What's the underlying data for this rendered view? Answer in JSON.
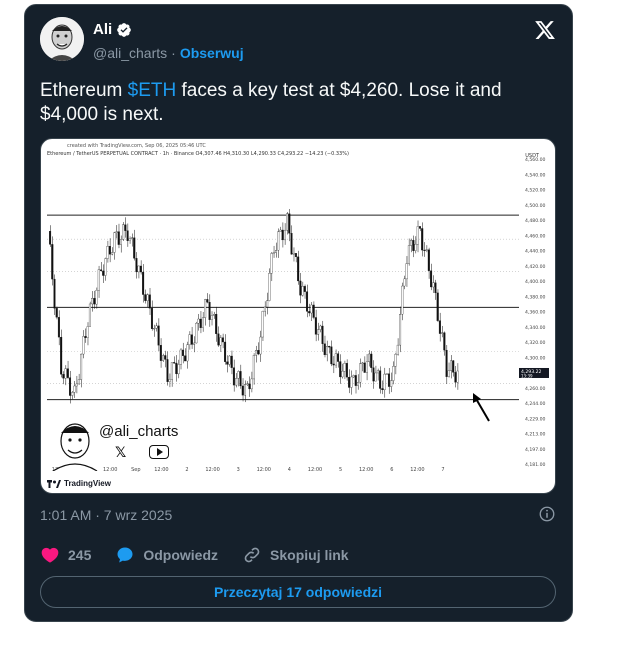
{
  "author": {
    "name": "Ali",
    "handle": "@ali_charts",
    "separator": "·",
    "follow_label": "Obserwuj",
    "verified": true
  },
  "tweet": {
    "text_before": "Ethereum ",
    "cashtag": "$ETH",
    "text_after": " faces a key test at $4,260. Lose it and $4,000 is next."
  },
  "media": {
    "created_with": "created with TradingView.com, Sep 06, 2025 05:46 UTC",
    "symbol_line": "Ethereum / TetherUS PERPETUAL CONTRACT · 1h · Binance  O4,307.46  H4,310.30  L4,290.33  C4,293.22  −14.23 (−0.33%)",
    "currency": "USDT",
    "price_ticks": [
      "4,560.00",
      "4,540.00",
      "4,520.00",
      "4,500.00",
      "4,480.00",
      "4,460.00",
      "4,440.00",
      "4,420.00",
      "4,400.00",
      "4,380.00",
      "4,360.00",
      "4,340.00",
      "4,320.00",
      "4,300.00",
      "4,280.00",
      "4,260.00",
      "4,244.00",
      "4,229.00",
      "4,213.00",
      "4,197.00",
      "4,181.00"
    ],
    "price_label": "4,293.22",
    "price_label_time": "13:39",
    "time_ticks": [
      "12:00",
      "31",
      "12:00",
      "Sep",
      "12:00",
      "2",
      "12:00",
      "3",
      "12:00",
      "4",
      "12:00",
      "5",
      "12:00",
      "6",
      "12:00",
      "7"
    ],
    "watermark_handle": "@ali_charts",
    "tv_brand": "TradingView"
  },
  "chart_data": {
    "type": "line",
    "title": "",
    "ylabel": "USDT",
    "ylim": [
      4181,
      4560
    ],
    "support_levels": [
      4260,
      4375,
      4490
    ],
    "x": [
      "12:00",
      "31",
      "12:00",
      "Sep",
      "12:00",
      "2",
      "12:00",
      "3",
      "12:00",
      "4",
      "12:00",
      "5",
      "12:00",
      "6"
    ],
    "series": [
      {
        "values": [
          4470,
          4300,
          4265,
          4360,
          4420,
          4460,
          4470,
          4410,
          4350,
          4290,
          4310,
          4340,
          4380,
          4330,
          4290,
          4270,
          4340,
          4450,
          4480,
          4400,
          4360,
          4320,
          4300,
          4280,
          4310,
          4280,
          4290,
          4440,
          4470,
          4400,
          4300,
          4290
        ]
      }
    ]
  },
  "meta": {
    "timestamp": "1:01 AM · 7 wrz 2025"
  },
  "actions": {
    "like_count": "245",
    "reply_label": "Odpowiedz",
    "copy_link_label": "Skopiuj link",
    "read_replies_label": "Przeczytaj 17 odpowiedzi"
  },
  "colors": {
    "background": "#15202b",
    "accent": "#1d9bf0",
    "like": "#f91880",
    "muted": "#8b98a5"
  }
}
